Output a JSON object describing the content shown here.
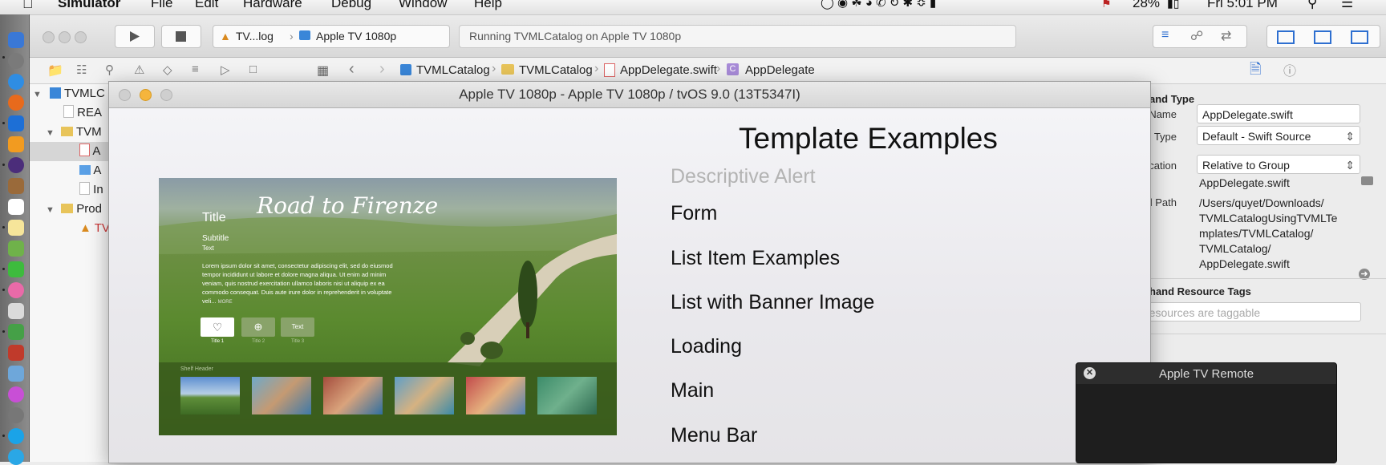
{
  "menubar": {
    "app": "Simulator",
    "items": [
      "File",
      "Edit",
      "Hardware",
      "Debug",
      "Window",
      "Help"
    ],
    "battery": "28%",
    "clock": "Fri 5:01 PM"
  },
  "toolbar": {
    "scheme": "TV...log",
    "device": "Apple TV 1080p",
    "activity": "Running TVMLCatalog on Apple TV 1080p"
  },
  "jumpbar": {
    "crumbs": [
      "TVMLCatalog",
      "TVMLCatalog",
      "AppDelegate.swift",
      "AppDelegate"
    ]
  },
  "navigator": {
    "rows": [
      "TVMLC",
      "REA",
      "TVM",
      "A",
      "A",
      "In",
      "Prod",
      "TV"
    ]
  },
  "inspector": {
    "section_identity": "and Type",
    "name_label": "Name",
    "name_value": "AppDelegate.swift",
    "type_label": "Type",
    "type_value": "Default - Swift Source",
    "location_label": "Location",
    "location_value": "Relative to Group",
    "location_file": "AppDelegate.swift",
    "fullpath_label": "Full Path",
    "fullpath_lines": [
      "/Users/quyet/Downloads/",
      "TVMLCatalogUsingTVMLTe",
      "mplates/TVMLCatalog/",
      "TVMLCatalog/",
      "AppDelegate.swift"
    ],
    "section_tags": "hand Resource Tags",
    "tags_placeholder": "resources are taggable"
  },
  "simulator": {
    "window_title": "Apple TV 1080p - Apple TV 1080p / tvOS 9.0 (13T5347I)",
    "heading": "Template Examples",
    "menu_items": [
      "Descriptive Alert",
      "Form",
      "List Item Examples",
      "List with Banner Image",
      "Loading",
      "Main",
      "Menu Bar"
    ],
    "preview": {
      "script_title": "Road to Firenze",
      "title": "Title",
      "subtitle": "Subtitle",
      "text": "Text",
      "body": "Lorem ipsum dolor sit amet, consectetur adipiscing elit, sed do eiusmod tempor incididunt ut labore et dolore magna aliqua. Ut enim ad minim veniam, quis nostrud exercitation ullamco laboris nisi ut aliquip ex ea commodo consequat. Duis aute irure dolor in reprehenderit in voluptate veli...",
      "more": "MORE",
      "button_text": "Text",
      "button_labels": [
        "Title 1",
        "Title 2",
        "Title 3"
      ],
      "shelf_header": "Shelf Header"
    }
  },
  "remote": {
    "title": "Apple TV Remote"
  }
}
